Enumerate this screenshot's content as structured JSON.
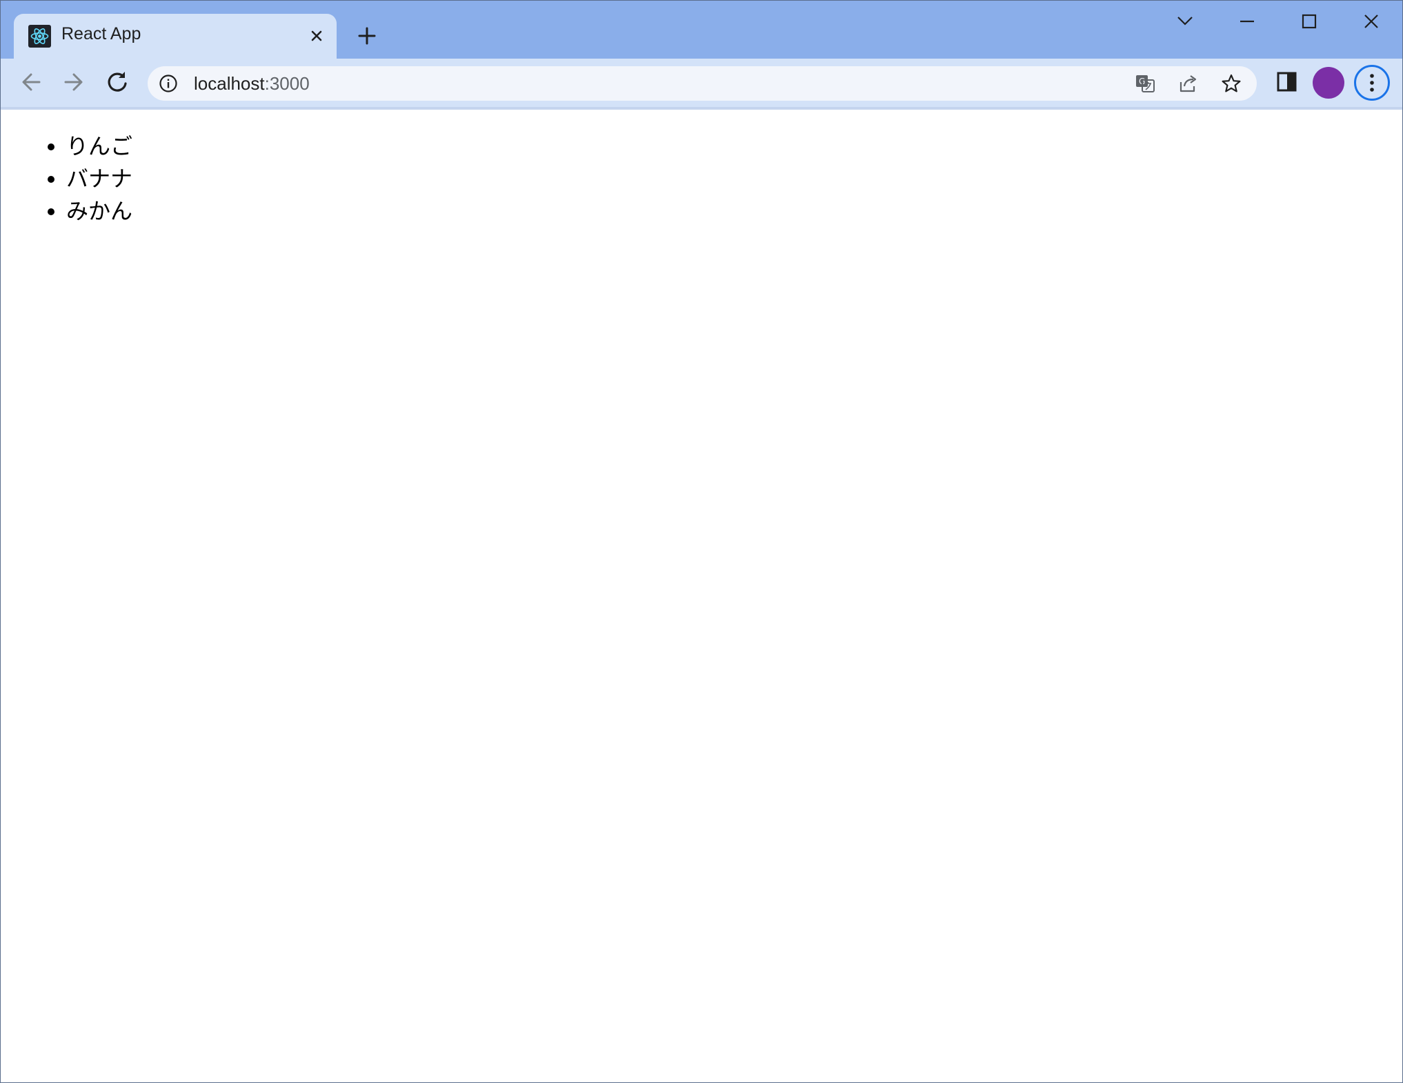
{
  "browser": {
    "tab": {
      "title": "React App",
      "favicon": "react-icon"
    },
    "new_tab": "plus-icon",
    "window_controls": [
      "chevron-down-icon",
      "minimize-icon",
      "maximize-icon",
      "close-icon"
    ],
    "address_bar": {
      "host": "localhost",
      "port": ":3000"
    },
    "omnibox_actions": [
      "translate-icon",
      "share-icon",
      "star-icon"
    ],
    "toolbar_actions": [
      "side-panel-icon",
      "avatar",
      "kebab-menu-icon"
    ],
    "colors": {
      "titlebar": "#8aaeea",
      "toolbar": "#d3e2f8",
      "profile": "#7b2fa6",
      "accent": "#1a73e8"
    }
  },
  "page": {
    "list": [
      {
        "label": "りんご"
      },
      {
        "label": "バナナ"
      },
      {
        "label": "みかん"
      }
    ]
  }
}
